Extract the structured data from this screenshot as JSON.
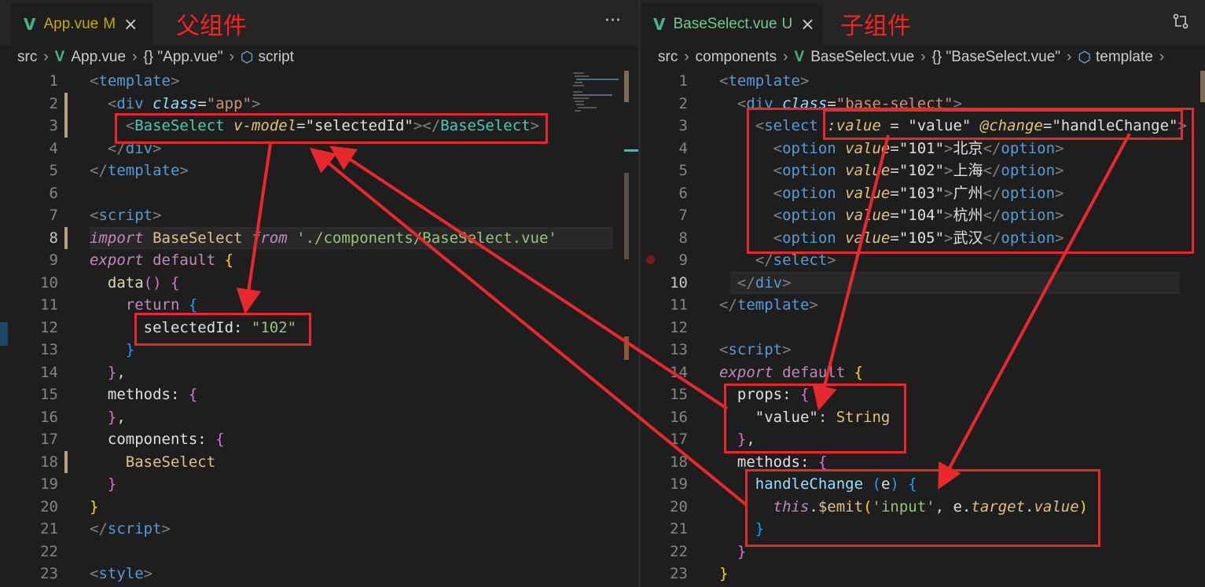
{
  "left": {
    "tab": {
      "icon": "vue-icon",
      "name": "App.vue",
      "status": "M",
      "close": "×"
    },
    "annotation": "父组件",
    "more": "···",
    "breadcrumb": [
      "src",
      "App.vue",
      "{} \"App.vue\"",
      "script"
    ],
    "lines": [
      {
        "n": "1",
        "tokens": [
          [
            "tag-br",
            "<"
          ],
          [
            "tag",
            "template"
          ],
          [
            "tag-br",
            ">"
          ]
        ]
      },
      {
        "n": "2",
        "tokens": [
          [
            "ws",
            "  "
          ],
          [
            "tag-br",
            "<"
          ],
          [
            "tag",
            "div "
          ],
          [
            "attr",
            "class"
          ],
          [
            "plain",
            "="
          ],
          [
            "str",
            "\"app\""
          ],
          [
            "tag-br",
            ">"
          ]
        ]
      },
      {
        "n": "3",
        "tokens": [
          [
            "ws",
            "    "
          ],
          [
            "tag-br",
            "<"
          ],
          [
            "comp",
            "BaseSelect "
          ],
          [
            "attr2",
            "v-model"
          ],
          [
            "plain",
            "="
          ],
          [
            "white",
            "\"selectedId\""
          ],
          [
            "tag-br",
            ">"
          ],
          [
            "tag-br",
            "</"
          ],
          [
            "comp",
            "BaseSelect"
          ],
          [
            "tag-br",
            ">"
          ]
        ]
      },
      {
        "n": "4",
        "tokens": [
          [
            "ws",
            "  "
          ],
          [
            "tag-br",
            "</"
          ],
          [
            "tag",
            "div"
          ],
          [
            "tag-br",
            ">"
          ]
        ]
      },
      {
        "n": "5",
        "tokens": [
          [
            "tag-br",
            "</"
          ],
          [
            "tag",
            "template"
          ],
          [
            "tag-br",
            ">"
          ]
        ]
      },
      {
        "n": "6",
        "tokens": []
      },
      {
        "n": "7",
        "tokens": [
          [
            "tag-br",
            "<"
          ],
          [
            "tag",
            "script"
          ],
          [
            "tag-br",
            ">"
          ]
        ]
      },
      {
        "n": "8",
        "tokens": [
          [
            "kw",
            "import "
          ],
          [
            "id",
            "BaseSelect "
          ],
          [
            "kw",
            "from "
          ],
          [
            "strg",
            "'./components/BaseSelect.vue'"
          ]
        ]
      },
      {
        "n": "9",
        "tokens": [
          [
            "kw",
            "export "
          ],
          [
            "kw2",
            "default "
          ],
          [
            "y",
            "{"
          ]
        ]
      },
      {
        "n": "10",
        "tokens": [
          [
            "ws",
            "  "
          ],
          [
            "fn",
            "data"
          ],
          [
            "p",
            "() "
          ],
          [
            "p",
            "{"
          ]
        ]
      },
      {
        "n": "11",
        "tokens": [
          [
            "ws",
            "    "
          ],
          [
            "kw2",
            "return "
          ],
          [
            "b",
            "{"
          ]
        ]
      },
      {
        "n": "12",
        "tokens": [
          [
            "ws",
            "      "
          ],
          [
            "white",
            "selectedId: "
          ],
          [
            "strg",
            "\"102\""
          ]
        ]
      },
      {
        "n": "13",
        "tokens": [
          [
            "ws",
            "    "
          ],
          [
            "b",
            "}"
          ]
        ]
      },
      {
        "n": "14",
        "tokens": [
          [
            "ws",
            "  "
          ],
          [
            "p",
            "}"
          ],
          [
            "plain",
            ","
          ]
        ]
      },
      {
        "n": "15",
        "tokens": [
          [
            "ws",
            "  "
          ],
          [
            "white",
            "methods: "
          ],
          [
            "p",
            "{"
          ]
        ]
      },
      {
        "n": "16",
        "tokens": [
          [
            "ws",
            "  "
          ],
          [
            "p",
            "}"
          ],
          [
            "plain",
            ","
          ]
        ]
      },
      {
        "n": "17",
        "tokens": [
          [
            "ws",
            "  "
          ],
          [
            "white",
            "components: "
          ],
          [
            "p",
            "{"
          ]
        ]
      },
      {
        "n": "18",
        "tokens": [
          [
            "ws",
            "    "
          ],
          [
            "id",
            "BaseSelect"
          ]
        ]
      },
      {
        "n": "19",
        "tokens": [
          [
            "ws",
            "  "
          ],
          [
            "p",
            "}"
          ]
        ]
      },
      {
        "n": "20",
        "tokens": [
          [
            "y",
            "}"
          ]
        ]
      },
      {
        "n": "21",
        "tokens": [
          [
            "tag-br",
            "</"
          ],
          [
            "tag",
            "script"
          ],
          [
            "tag-br",
            ">"
          ]
        ]
      },
      {
        "n": "22",
        "tokens": []
      },
      {
        "n": "23",
        "tokens": [
          [
            "tag-br",
            "<"
          ],
          [
            "tag",
            "style"
          ],
          [
            "tag-br",
            ">"
          ]
        ]
      }
    ]
  },
  "right": {
    "tab": {
      "icon": "vue-icon",
      "name": "BaseSelect.vue",
      "status": "U",
      "close": "×"
    },
    "annotation": "子组件",
    "breadcrumb": [
      "src",
      "components",
      "BaseSelect.vue",
      "{} \"BaseSelect.vue\"",
      "template"
    ],
    "lines": [
      {
        "n": "1",
        "tokens": [
          [
            "tag-br",
            "<"
          ],
          [
            "tag",
            "template"
          ],
          [
            "tag-br",
            ">"
          ]
        ]
      },
      {
        "n": "2",
        "tokens": [
          [
            "ws",
            "  "
          ],
          [
            "tag-br",
            "<"
          ],
          [
            "tag",
            "div "
          ],
          [
            "attr",
            "class"
          ],
          [
            "plain",
            "="
          ],
          [
            "str",
            "\"base-select\""
          ],
          [
            "tag-br",
            ">"
          ]
        ]
      },
      {
        "n": "3",
        "tokens": [
          [
            "ws",
            "    "
          ],
          [
            "tag-br",
            "<"
          ],
          [
            "tag",
            "select "
          ],
          [
            "attr2",
            ":value"
          ],
          [
            "plain",
            " = "
          ],
          [
            "white",
            "\"value\" "
          ],
          [
            "attr2",
            "@change"
          ],
          [
            "plain",
            "="
          ],
          [
            "white",
            "\"handleChange\""
          ],
          [
            "tag-br",
            ">"
          ]
        ]
      },
      {
        "n": "4",
        "tokens": [
          [
            "ws",
            "      "
          ],
          [
            "tag-br",
            "<"
          ],
          [
            "tag",
            "option "
          ],
          [
            "attr2",
            "value"
          ],
          [
            "plain",
            "="
          ],
          [
            "white",
            "\"101\""
          ],
          [
            "tag-br",
            ">"
          ],
          [
            "white",
            "北京"
          ],
          [
            "tag-br",
            "</"
          ],
          [
            "tag",
            "option"
          ],
          [
            "tag-br",
            ">"
          ]
        ]
      },
      {
        "n": "5",
        "tokens": [
          [
            "ws",
            "      "
          ],
          [
            "tag-br",
            "<"
          ],
          [
            "tag",
            "option "
          ],
          [
            "attr2",
            "value"
          ],
          [
            "plain",
            "="
          ],
          [
            "white",
            "\"102\""
          ],
          [
            "tag-br",
            ">"
          ],
          [
            "white",
            "上海"
          ],
          [
            "tag-br",
            "</"
          ],
          [
            "tag",
            "option"
          ],
          [
            "tag-br",
            ">"
          ]
        ]
      },
      {
        "n": "6",
        "tokens": [
          [
            "ws",
            "      "
          ],
          [
            "tag-br",
            "<"
          ],
          [
            "tag",
            "option "
          ],
          [
            "attr2",
            "value"
          ],
          [
            "plain",
            "="
          ],
          [
            "white",
            "\"103\""
          ],
          [
            "tag-br",
            ">"
          ],
          [
            "white",
            "广州"
          ],
          [
            "tag-br",
            "</"
          ],
          [
            "tag",
            "option"
          ],
          [
            "tag-br",
            ">"
          ]
        ]
      },
      {
        "n": "7",
        "tokens": [
          [
            "ws",
            "      "
          ],
          [
            "tag-br",
            "<"
          ],
          [
            "tag",
            "option "
          ],
          [
            "attr2",
            "value"
          ],
          [
            "plain",
            "="
          ],
          [
            "white",
            "\"104\""
          ],
          [
            "tag-br",
            ">"
          ],
          [
            "white",
            "杭州"
          ],
          [
            "tag-br",
            "</"
          ],
          [
            "tag",
            "option"
          ],
          [
            "tag-br",
            ">"
          ]
        ]
      },
      {
        "n": "8",
        "tokens": [
          [
            "ws",
            "      "
          ],
          [
            "tag-br",
            "<"
          ],
          [
            "tag",
            "option "
          ],
          [
            "attr2",
            "value"
          ],
          [
            "plain",
            "="
          ],
          [
            "white",
            "\"105\""
          ],
          [
            "tag-br",
            ">"
          ],
          [
            "white",
            "武汉"
          ],
          [
            "tag-br",
            "</"
          ],
          [
            "tag",
            "option"
          ],
          [
            "tag-br",
            ">"
          ]
        ]
      },
      {
        "n": "9",
        "tokens": [
          [
            "ws",
            "    "
          ],
          [
            "tag-br",
            "</"
          ],
          [
            "tag",
            "select"
          ],
          [
            "tag-br",
            ">"
          ]
        ]
      },
      {
        "n": "10",
        "tokens": [
          [
            "ws",
            "  "
          ],
          [
            "tag-br",
            "</"
          ],
          [
            "tag",
            "div"
          ],
          [
            "tag-br",
            ">"
          ]
        ]
      },
      {
        "n": "11",
        "tokens": [
          [
            "tag-br",
            "</"
          ],
          [
            "tag",
            "template"
          ],
          [
            "tag-br",
            ">"
          ]
        ]
      },
      {
        "n": "12",
        "tokens": []
      },
      {
        "n": "13",
        "tokens": [
          [
            "tag-br",
            "<"
          ],
          [
            "tag",
            "script"
          ],
          [
            "tag-br",
            ">"
          ]
        ]
      },
      {
        "n": "14",
        "tokens": [
          [
            "kw",
            "export "
          ],
          [
            "kw2",
            "default "
          ],
          [
            "y",
            "{"
          ]
        ]
      },
      {
        "n": "15",
        "tokens": [
          [
            "ws",
            "  "
          ],
          [
            "white",
            "props: "
          ],
          [
            "p",
            "{"
          ]
        ]
      },
      {
        "n": "16",
        "tokens": [
          [
            "ws",
            "    "
          ],
          [
            "white",
            "\"value\""
          ],
          [
            "plain",
            ": "
          ],
          [
            "type",
            "String"
          ]
        ]
      },
      {
        "n": "17",
        "tokens": [
          [
            "ws",
            "  "
          ],
          [
            "p",
            "}"
          ],
          [
            "plain",
            ","
          ]
        ]
      },
      {
        "n": "18",
        "tokens": [
          [
            "ws",
            "  "
          ],
          [
            "white",
            "methods: "
          ],
          [
            "p",
            "{"
          ]
        ]
      },
      {
        "n": "19",
        "tokens": [
          [
            "ws",
            "    "
          ],
          [
            "prop",
            "handleChange "
          ],
          [
            "b",
            "("
          ],
          [
            "white",
            "e"
          ],
          [
            "b",
            ") "
          ],
          [
            "b",
            "{"
          ]
        ]
      },
      {
        "n": "20",
        "tokens": [
          [
            "ws",
            "      "
          ],
          [
            "kw",
            "this"
          ],
          [
            "plain",
            "."
          ],
          [
            "id",
            "$emit"
          ],
          [
            "y",
            "("
          ],
          [
            "strg",
            "'input'"
          ],
          [
            "plain",
            ", "
          ],
          [
            "white",
            "e."
          ],
          [
            "attr2",
            "target"
          ],
          [
            "plain",
            "."
          ],
          [
            "attr2",
            "value"
          ],
          [
            "y",
            ")"
          ]
        ]
      },
      {
        "n": "21",
        "tokens": [
          [
            "ws",
            "    "
          ],
          [
            "b",
            "}"
          ]
        ]
      },
      {
        "n": "22",
        "tokens": [
          [
            "ws",
            "  "
          ],
          [
            "p",
            "}"
          ]
        ]
      },
      {
        "n": "23",
        "tokens": [
          [
            "y",
            "}"
          ]
        ]
      }
    ]
  },
  "colors": {
    "annotation": "#e8282c",
    "vue": "#41b883",
    "modified": "#cca700",
    "untracked": "#73c991"
  }
}
